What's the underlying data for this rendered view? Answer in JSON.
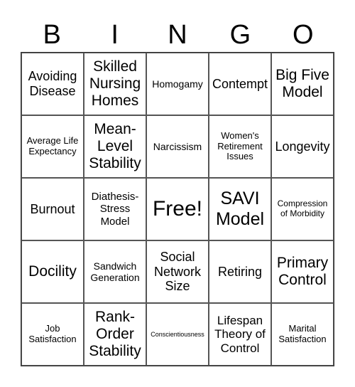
{
  "header": {
    "letters": [
      "B",
      "I",
      "N",
      "G",
      "O"
    ]
  },
  "cells": [
    "Avoiding Disease",
    "Skilled Nursing Homes",
    "Homogamy",
    "Contempt",
    "Big Five Model",
    "Average Life Expectancy",
    "Mean-Level Stability",
    "Narcissism",
    "Women's Retirement Issues",
    "Longevity",
    "Burnout",
    "Diathesis-Stress Model",
    "Free!",
    "SAVI Model",
    "Compression of Morbidity",
    "Docility",
    "Sandwich Generation",
    "Social Network Size",
    "Retiring",
    "Primary Control",
    "Job Satisfaction",
    "Rank-Order Stability",
    "Conscientiousness",
    "Lifespan Theory of Control",
    "Marital Satisfaction"
  ]
}
